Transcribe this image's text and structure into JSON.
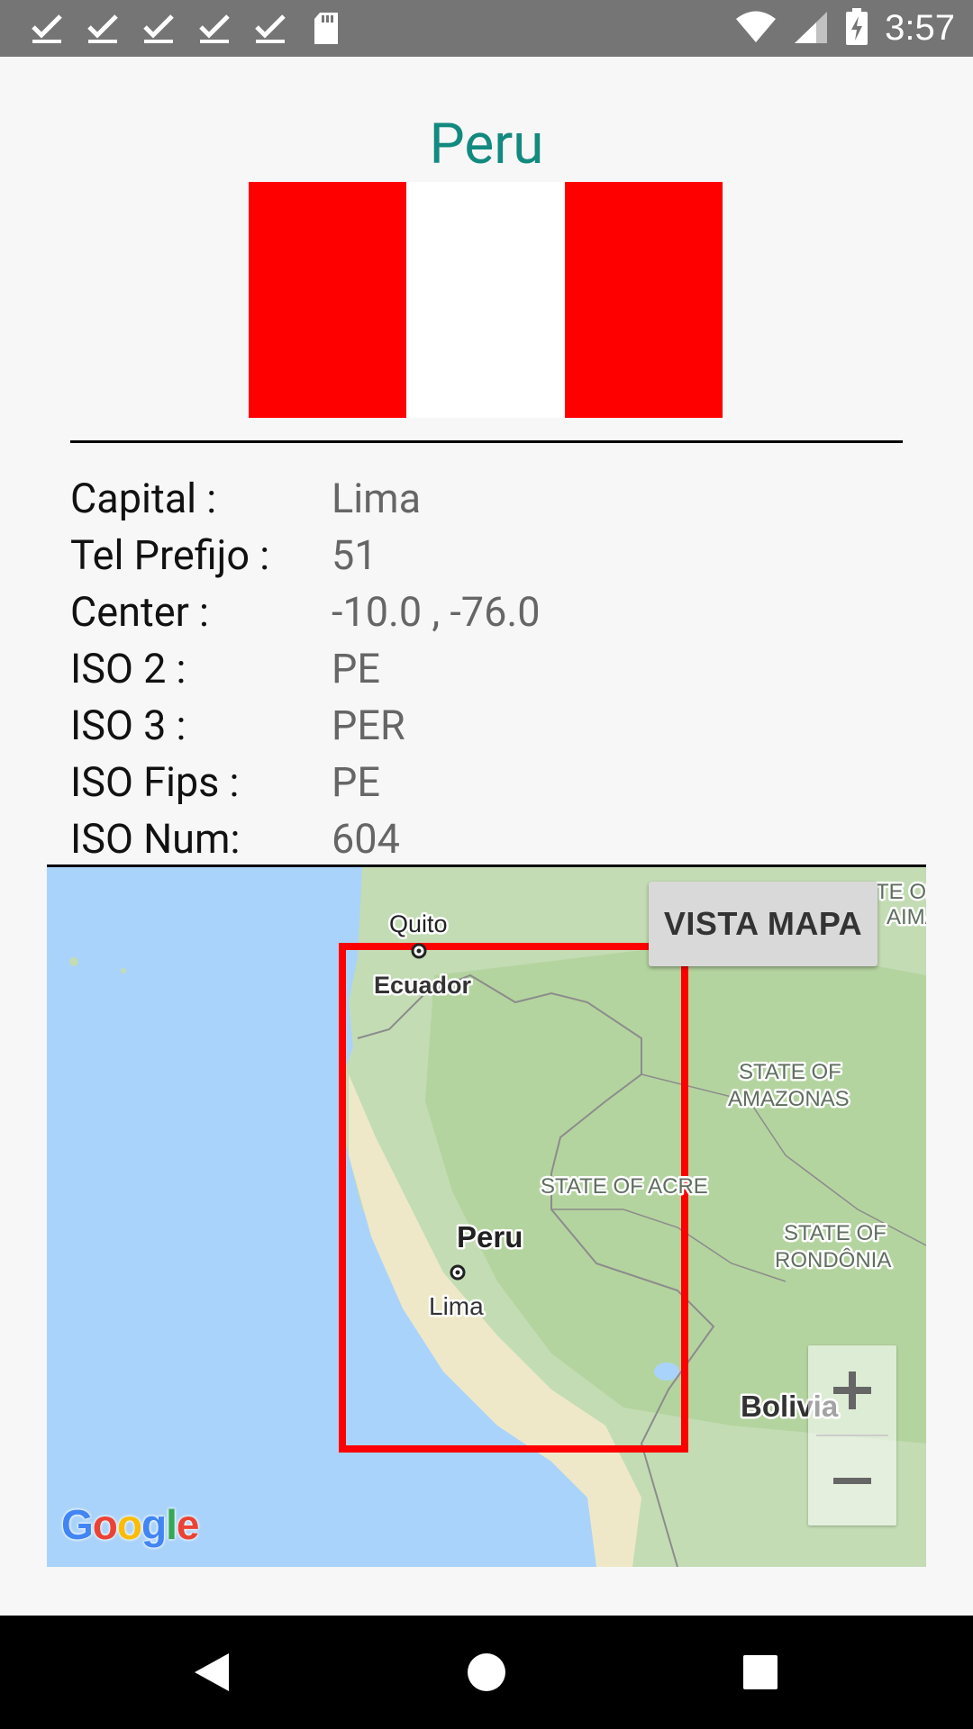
{
  "status_bar": {
    "time": "3:57",
    "left_icons": [
      "check-icon",
      "check-icon",
      "check-icon",
      "check-icon",
      "check-icon",
      "sd-card-icon"
    ],
    "right_icons": [
      "wifi-icon",
      "signal-icon",
      "battery-charging-icon"
    ]
  },
  "country": {
    "name": "Peru",
    "flag_colors": [
      "#ff0000",
      "#ffffff",
      "#ff0000"
    ]
  },
  "info": [
    {
      "label": "Capital :",
      "value": "Lima"
    },
    {
      "label": "Tel Prefijo :",
      "value": "51"
    },
    {
      "label": "Center :",
      "value": "-10.0 , -76.0"
    },
    {
      "label": "ISO 2 :",
      "value": "PE"
    },
    {
      "label": "ISO 3 :",
      "value": "PER"
    },
    {
      "label": "ISO Fips :",
      "value": "PE"
    },
    {
      "label": "ISO Num:",
      "value": "604"
    }
  ],
  "map": {
    "button_label": "VISTA MAPA",
    "labels": {
      "quito": "Quito",
      "ecuador": "Ecuador",
      "peru": "Peru",
      "lima": "Lima",
      "amazonas_1": "STATE OF",
      "amazonas_2": "AMAZONAS",
      "acre": "STATE OF ACRE",
      "rondonia_1": "STATE OF",
      "rondonia_2": "RONDÔNIA",
      "bolivia": "Bolivia",
      "top_right_1": "TE OF",
      "top_right_2": "AIMA"
    },
    "zoom_in": "+",
    "zoom_out": "−",
    "attribution": "Google",
    "highlight_color": "#ff0000"
  },
  "nav_bar": {
    "back": "back-icon",
    "home": "home-icon",
    "recents": "recents-icon"
  }
}
